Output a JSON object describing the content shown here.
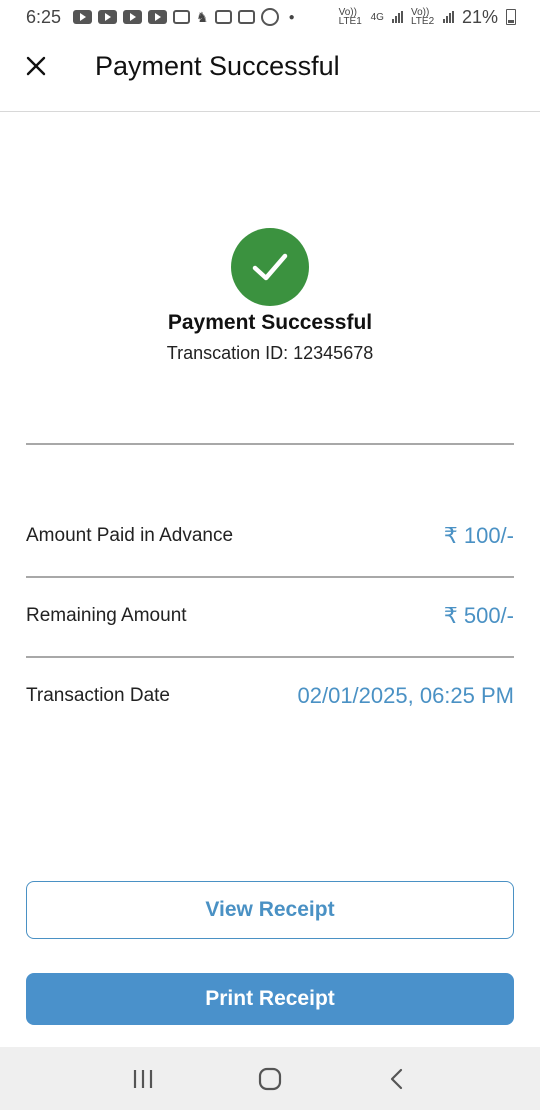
{
  "status_bar": {
    "time": "6:25",
    "network_1": "Vo)) LTE1",
    "network_type": "4G",
    "network_2": "Vo)) LTE2",
    "battery": "21%",
    "notification_icons": [
      "youtube-icon",
      "youtube-icon",
      "youtube-icon",
      "youtube-icon",
      "gmail-icon",
      "game-icon",
      "gmail-icon",
      "tv-icon",
      "whatsapp-icon"
    ]
  },
  "app_bar": {
    "title": "Payment Successful",
    "close_icon": "close-icon"
  },
  "result": {
    "icon": "check-icon",
    "icon_color": "#3b923f",
    "title": "Payment Successful",
    "transaction_id": "Transcation ID: 12345678"
  },
  "details": [
    {
      "label": "Amount Paid in Advance",
      "value": "₹ 100/-"
    },
    {
      "label": "Remaining Amount",
      "value": "₹ 500/-"
    },
    {
      "label": "Transaction Date",
      "value": "02/01/2025, 06:25 PM"
    }
  ],
  "buttons": {
    "view_receipt": "View Receipt",
    "print_receipt": "Print Receipt"
  },
  "colors": {
    "accent": "#4a91c4",
    "success": "#3b923f"
  },
  "nav_bar": {
    "recents_icon": "recents-icon",
    "home_icon": "home-icon",
    "back_icon": "back-icon"
  }
}
